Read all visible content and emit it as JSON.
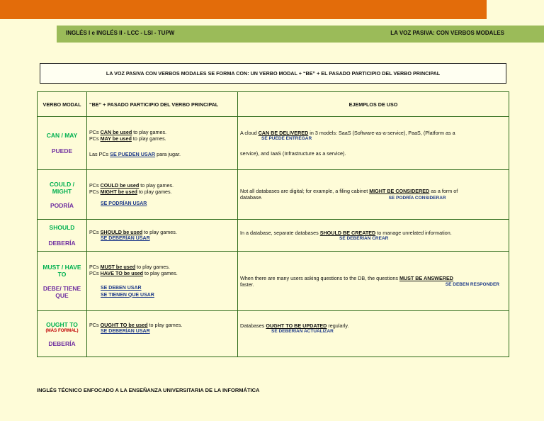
{
  "header": {
    "left": "INGLÉS I e INGLÉS II - LCC - LSI - TUPW",
    "right": "LA VOZ PASIVA: CON VERBOS MODALES"
  },
  "definition": "LA VOZ PASIVA CON VERBOS MODALES SE FORMA CON: UN VERBO MODAL + “BE” + EL PASADO PARTICIPIO DEL VERBO PRINCIPAL",
  "table": {
    "headers": [
      "VERBO MODAL",
      "“BE” + PASADO PARTICIPIO DEL VERBO PRINCIPAL",
      "EJEMPLOS DE USO"
    ],
    "rows": [
      {
        "modal_en": "CAN / MAY",
        "modal_es": "PUEDE",
        "col2": {
          "l1a": "PCs ",
          "l1b": "CAN be used",
          "l1c": " to play games.",
          "l2a": "PCs ",
          "l2b": "MAY be used",
          "l2c": " to play games.",
          "l3a": "Las PCs ",
          "l3b": "SE PUEDEN USAR",
          "l3c": " para jugar."
        },
        "col3": {
          "a": "A cloud ",
          "b": "CAN BE DELIVERED",
          "c": " in 3 models: SaaS (Software-as-a-service), PaaS, (Platform as a",
          "tr": "SE PUEDE ENTREGAR",
          "d": "service), and IaaS (Infrastructure as a service)."
        }
      },
      {
        "modal_en": "COULD / MIGHT",
        "modal_es": "PODRÍA",
        "col2": {
          "l1a": "PCs ",
          "l1b": "COULD be used",
          "l1c": " to play games.",
          "l2a": "PCs ",
          "l2b": "MIGHT be used",
          "l2c": " to play games.",
          "tr": "SE PODRÍAN USAR"
        },
        "col3": {
          "a": "Not all databases are digital; for example, a filing cabinet ",
          "b": "MIGHT BE CONSIDERED",
          "c": " as a form of",
          "d": "database.",
          "tr": "SE PODRÍA CONSIDERAR"
        }
      },
      {
        "modal_en": "SHOULD",
        "modal_es": "DEBERÍA",
        "col2": {
          "l1a": "PCs ",
          "l1b": "SHOULD be used",
          "l1c": " to play games.",
          "tr": "SE DEBERÍAN USAR"
        },
        "col3": {
          "a": "In a database, separate databases ",
          "b": "SHOULD BE CREATED",
          "c": " to manage unrelated information.",
          "tr": "SE DEBERÍAN CREAR"
        }
      },
      {
        "modal_en": "MUST / HAVE TO",
        "modal_es": "DEBE/ TIENE QUE",
        "col2": {
          "l1a": "PCs ",
          "l1b": "MUST be used",
          "l1c": " to play games.",
          "l2a": "PCs ",
          "l2b": "HAVE TO be used",
          "l2c": " to play games.",
          "tr1": "SE DEBEN USAR",
          "tr2": "SE TIENEN QUE USAR"
        },
        "col3": {
          "a": "When there are many users asking questions to the DB, the questions ",
          "b": "MUST BE ANSWERED",
          "d": "faster.",
          "tr": "SE DEBEN RESPONDER"
        }
      },
      {
        "modal_en": "OUGHT TO",
        "modal_formal": "(MÁS FORMAL)",
        "modal_es": "DEBERÍA",
        "col2": {
          "l1a": "PCs ",
          "l1b": "OUGHT TO be used",
          "l1c": " to play games.",
          "tr": "SE DEBERÍAN USAR"
        },
        "col3": {
          "a": "Databases ",
          "b": "OUGHT TO BE UPDATED",
          "c": " regularly.",
          "tr": "SE DEBERÍAN ACTUALIZAR"
        }
      }
    ]
  },
  "footer": "INGLÉS TÉCNICO ENFOCADO A LA ENSEÑANZA UNIVERSITARIA DE LA INFORMÁTICA"
}
